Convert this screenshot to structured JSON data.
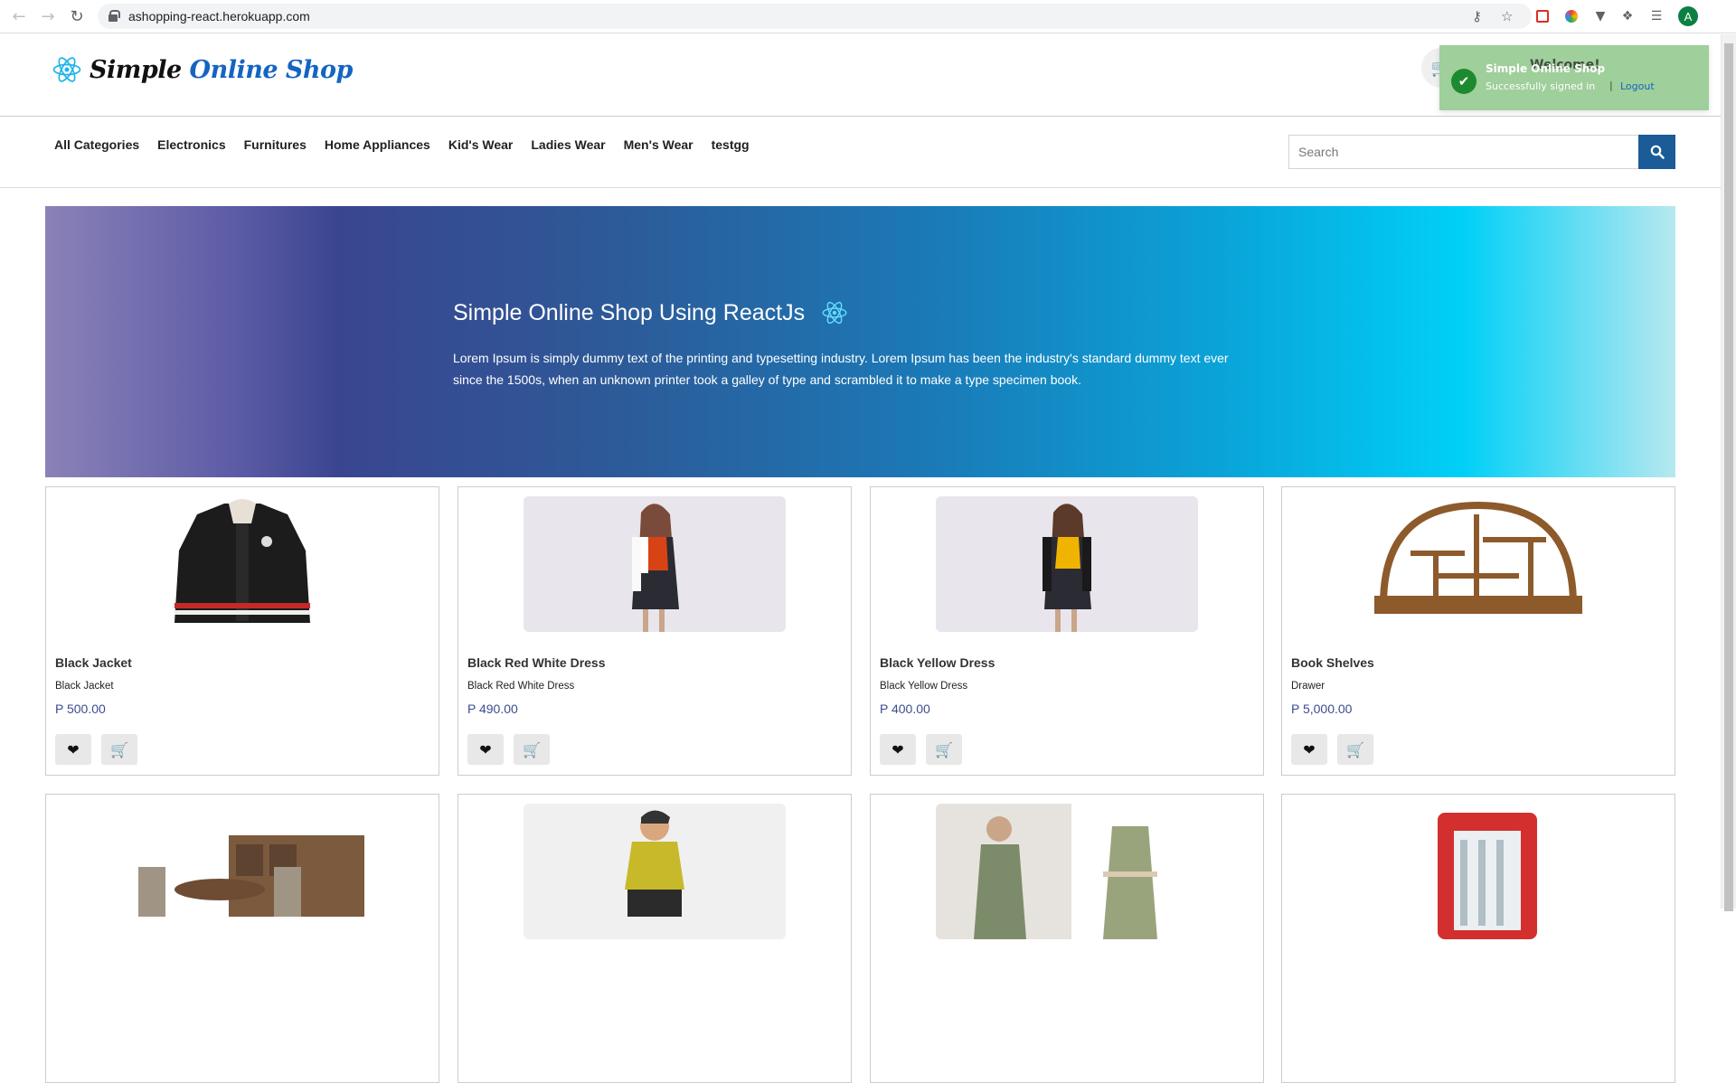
{
  "browser": {
    "url": "ashopping-react.herokuapp.com",
    "profile_initial": "A"
  },
  "header": {
    "brand_part1": "Simple",
    "brand_part2": "Online Shop"
  },
  "toast": {
    "title": "Simple Online Shop",
    "welcome": "Welcome!",
    "message": "Successfully signed in",
    "separator": "|",
    "logout_label": "Logout"
  },
  "categories": [
    "All Categories",
    "Electronics",
    "Furnitures",
    "Home Appliances",
    "Kid's Wear",
    "Ladies Wear",
    "Men's Wear",
    "testgg"
  ],
  "search": {
    "placeholder": "Search"
  },
  "hero": {
    "title": "Simple Online Shop Using ReactJs",
    "text": "Lorem Ipsum is simply dummy text of the printing and typesetting industry. Lorem Ipsum has been the industry's standard dummy text ever since the 1500s, when an unknown printer took a galley of type and scrambled it to make a type specimen book."
  },
  "products": [
    {
      "name": "Black Jacket",
      "desc": "Black Jacket",
      "price": "P 500.00"
    },
    {
      "name": "Black Red White Dress",
      "desc": "Black Red White Dress",
      "price": "P 490.00"
    },
    {
      "name": "Black Yellow Dress",
      "desc": "Black Yellow Dress",
      "price": "P 400.00"
    },
    {
      "name": "Book Shelves",
      "desc": "Drawer",
      "price": "P 5,000.00"
    }
  ],
  "colors": {
    "brand_blue": "#1565c0",
    "price": "#3d4c8e",
    "search_button": "#1a5b98",
    "toast_bg": "#9fcf9b"
  }
}
